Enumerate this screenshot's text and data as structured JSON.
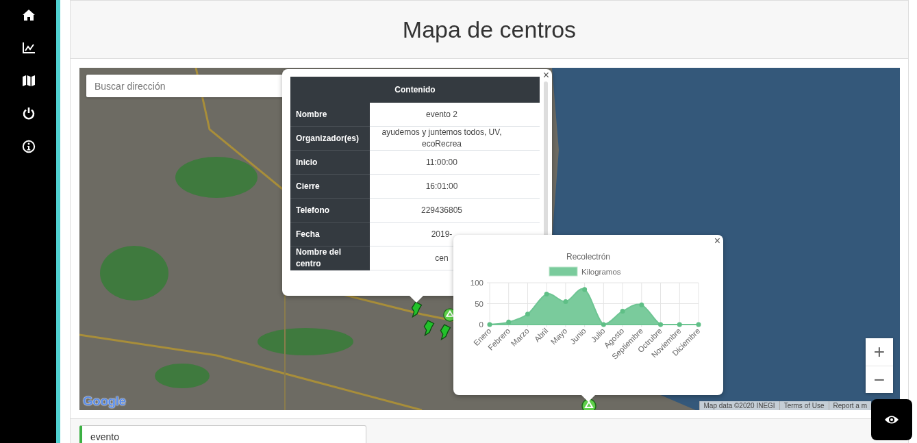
{
  "page": {
    "title": "Mapa de centros"
  },
  "map": {
    "search": {
      "placeholder": "Buscar dirección"
    },
    "info_popup": {
      "close": "×",
      "header": "Contenido",
      "rows": [
        {
          "label": "Nombre",
          "value": "evento 2"
        },
        {
          "label": "Organizador(es)",
          "value": "ayudemos y juntemos todos, UV, ecoRecrea"
        },
        {
          "label": "Inicio",
          "value": "11:00:00"
        },
        {
          "label": "Cierre",
          "value": "16:01:00"
        },
        {
          "label": "Telefono",
          "value": "229436805"
        },
        {
          "label": "Fecha",
          "value": "2019-"
        },
        {
          "label": "Nombre del centro",
          "value": "cen"
        }
      ]
    },
    "chart_popup": {
      "close": "×",
      "chart_data": {
        "type": "area",
        "grid": true,
        "title": "Recolectrón",
        "categories": [
          "Enero",
          "Febrero",
          "Marzo",
          "Abril",
          "Mayo",
          "Junio",
          "Julio",
          "Agosto",
          "Septiembre",
          "Octrubre",
          "Noviembre",
          "Diciembre"
        ],
        "ylim": [
          0,
          100
        ],
        "yticks": [
          0,
          50,
          100
        ],
        "series": [
          {
            "name": "Kilogramos",
            "color": "#7acb9c",
            "values": [
              0,
              6,
              25,
              73,
              55,
              84,
              0,
              32,
              47,
              0,
              0,
              0
            ]
          }
        ]
      }
    },
    "zoom": {
      "in": "+",
      "out": "−"
    },
    "logo": "Google",
    "attribution": [
      "Map data ©2020 INEGI",
      "Terms of Use",
      "Report a m"
    ]
  },
  "filter": {
    "value": "evento"
  }
}
